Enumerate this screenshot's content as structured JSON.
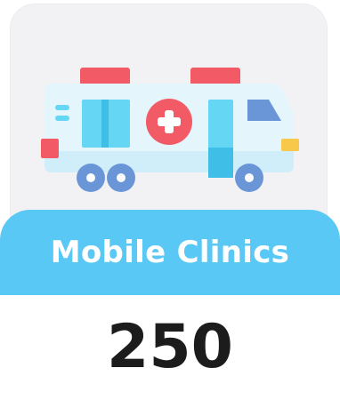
{
  "card": {
    "icon": "ambulance-icon",
    "label": "Mobile Clinics",
    "value": "250"
  },
  "colors": {
    "card_background": "#f2f2f4",
    "label_band": "#5ac8f5",
    "label_text": "#ffffff",
    "value_text": "#1c1c1c",
    "siren": "#f25a66",
    "vehicle_body": "#e4f5fc",
    "panel_blue": "#66d6f5",
    "wheel": "#6a96d8"
  }
}
